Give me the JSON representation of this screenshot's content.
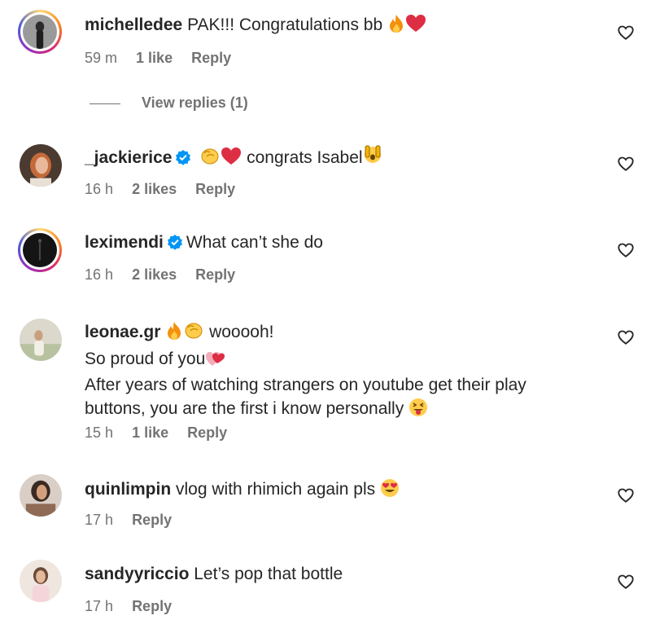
{
  "comments": [
    {
      "username": "michelledee",
      "text": "PAK!!! Congratulations bb",
      "emoji": [
        "fire-emoji",
        "red-heart-emoji"
      ],
      "time": "59 m",
      "likes": "1 like",
      "reply": "Reply",
      "view_replies": "View replies (1)"
    },
    {
      "username": "_jackierice",
      "verified": true,
      "emoji_pre": [
        "clapping-hands-emoji",
        "red-heart-emoji"
      ],
      "text": "congrats Isabel",
      "emoji_post": [
        "face-with-hand-over-mouth-emoji"
      ],
      "time": "16 h",
      "likes": "2 likes",
      "reply": "Reply"
    },
    {
      "username": "leximendi",
      "verified": true,
      "text": "What can’t she do",
      "time": "16 h",
      "likes": "2 likes",
      "reply": "Reply"
    },
    {
      "username": "leonae.gr",
      "emoji_pre": [
        "fire-emoji",
        "clapping-hands-emoji"
      ],
      "text": "wooooh!",
      "line2": "So proud of you",
      "line3": "After years of watching strangers on youtube get their play",
      "line4": "buttons, you are the first i know personally",
      "time": "15 h",
      "likes": "1 like",
      "reply": "Reply"
    },
    {
      "username": "quinlimpin",
      "text": "vlog with rhimich again pls",
      "emoji": [
        "heart-eyes-emoji"
      ],
      "time": "17 h",
      "reply": "Reply"
    },
    {
      "username": "sandyyriccio",
      "text": "Let’s pop that bottle",
      "time": "17 h",
      "reply": "Reply"
    }
  ],
  "colors": {
    "text": "#262626",
    "meta": "#737373",
    "verified": "#0095f6",
    "heart_emoji": "#e0245e"
  }
}
